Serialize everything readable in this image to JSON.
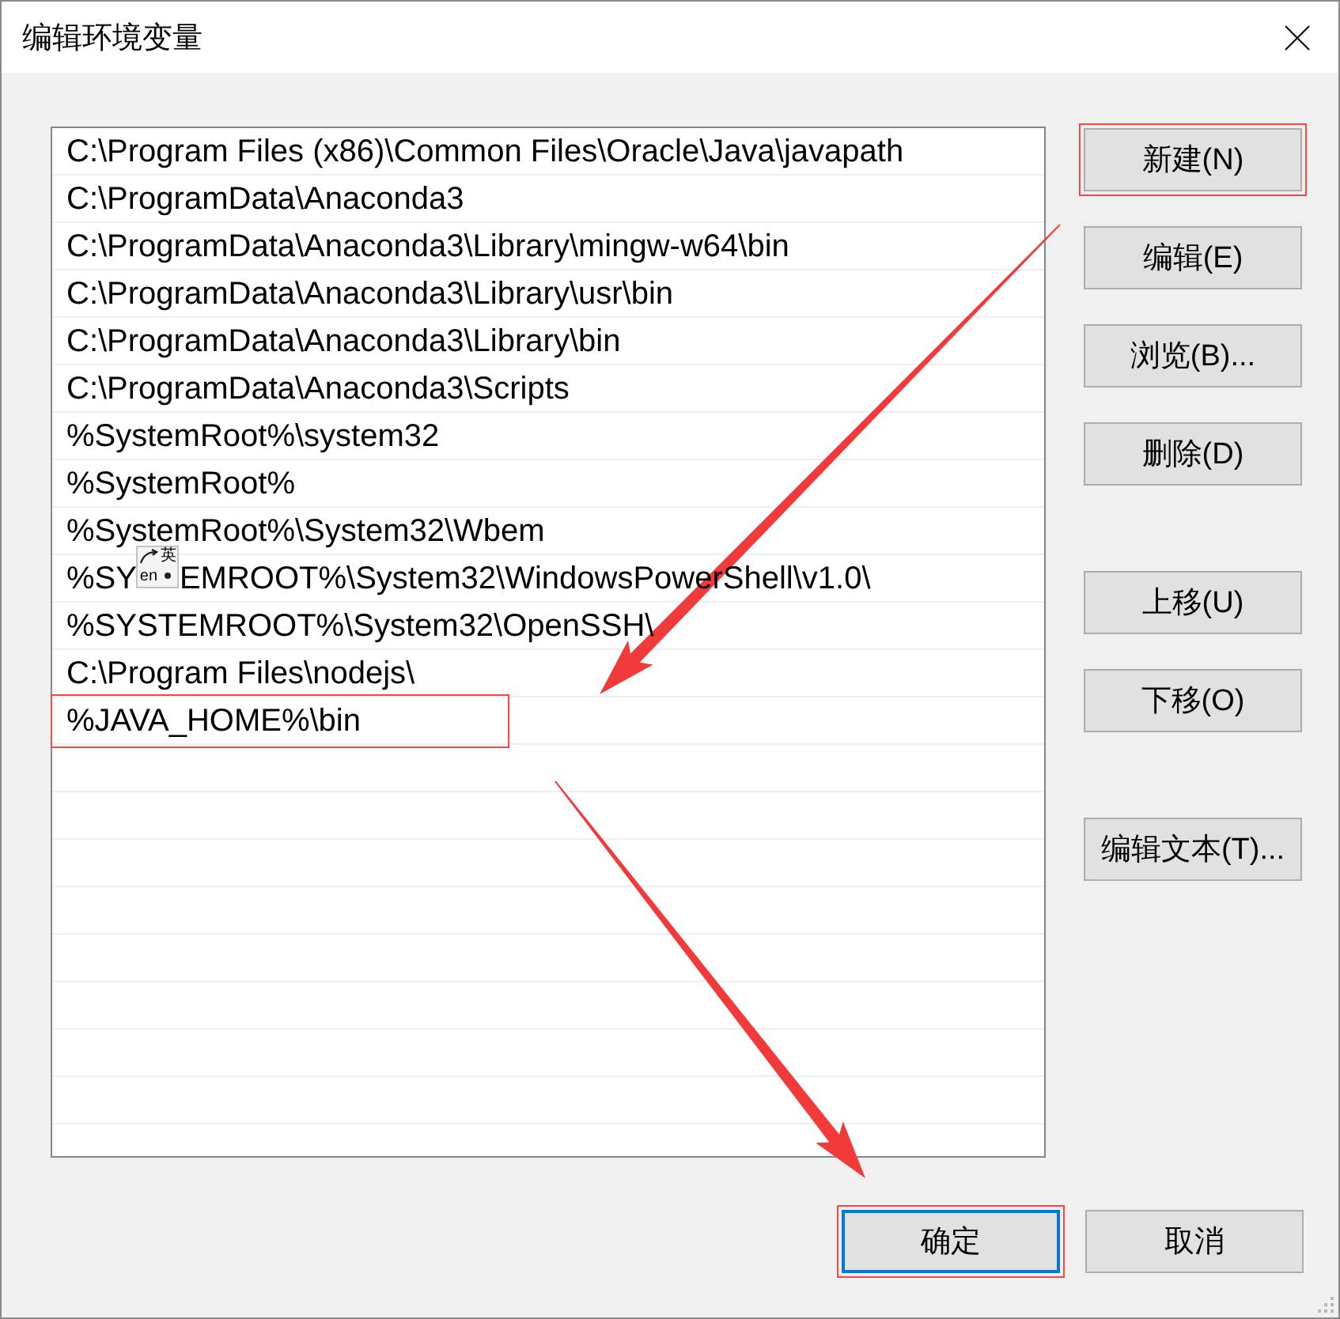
{
  "window": {
    "title": "编辑环境变量"
  },
  "paths": [
    {
      "text": "C:\\Program Files (x86)\\Common Files\\Oracle\\Java\\javapath",
      "highlighted": false
    },
    {
      "text": "C:\\ProgramData\\Anaconda3",
      "highlighted": false
    },
    {
      "text": "C:\\ProgramData\\Anaconda3\\Library\\mingw-w64\\bin",
      "highlighted": false
    },
    {
      "text": "C:\\ProgramData\\Anaconda3\\Library\\usr\\bin",
      "highlighted": false
    },
    {
      "text": "C:\\ProgramData\\Anaconda3\\Library\\bin",
      "highlighted": false
    },
    {
      "text": "C:\\ProgramData\\Anaconda3\\Scripts",
      "highlighted": false
    },
    {
      "text": "%SystemRoot%\\system32",
      "highlighted": false
    },
    {
      "text": "%SystemRoot%",
      "highlighted": false
    },
    {
      "text": "%SystemRoot%\\System32\\Wbem",
      "highlighted": false
    },
    {
      "text": "%SY",
      "ime_indicator": {
        "language": "英",
        "mode": "en"
      },
      "text_after_indicator": "EMROOT%\\System32\\WindowsPowerShell\\v1.0\\",
      "highlighted": false
    },
    {
      "text": "%SYSTEMROOT%\\System32\\OpenSSH\\",
      "highlighted": false
    },
    {
      "text": "C:\\Program Files\\nodejs\\",
      "highlighted": false
    },
    {
      "text": "%JAVA_HOME%\\bin",
      "highlighted": true
    }
  ],
  "side_button_groups": [
    [
      {
        "label": "新建(N)",
        "highlighted": true
      },
      {
        "label": "编辑(E)",
        "highlighted": false
      },
      {
        "label": "浏览(B)...",
        "highlighted": false
      },
      {
        "label": "删除(D)",
        "highlighted": false
      }
    ],
    [
      {
        "label": "上移(U)",
        "highlighted": false
      },
      {
        "label": "下移(O)",
        "highlighted": false
      }
    ],
    [
      {
        "label": "编辑文本(T)...",
        "highlighted": false
      }
    ]
  ],
  "footer_buttons": [
    {
      "label": "确定",
      "focused": true,
      "highlighted": true
    },
    {
      "label": "取消",
      "focused": false,
      "highlighted": false
    }
  ],
  "annotations": {
    "arrow_new_button_to_entry": true,
    "arrow_entry_to_confirm_button": true
  }
}
